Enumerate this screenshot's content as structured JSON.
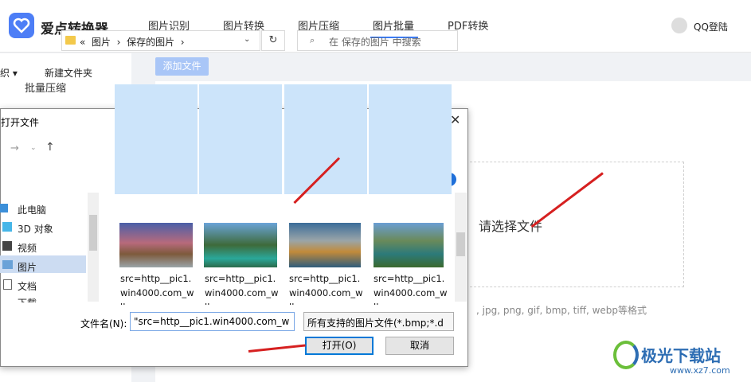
{
  "app": {
    "name": "爱点转换器",
    "login": "QQ登陆"
  },
  "nav": [
    {
      "label": "图片识别"
    },
    {
      "label": "图片转换"
    },
    {
      "label": "图片压缩"
    },
    {
      "label": "图片批量"
    },
    {
      "label": "PDF转换"
    }
  ],
  "sidebar": {
    "item": "批量压缩"
  },
  "main": {
    "add_button": "添加文件",
    "drop_text": "请选择文件",
    "formats": ", jpg, png, gif, bmp, tiff, webp等格式"
  },
  "dialog": {
    "title": "打开文件",
    "breadcrumb_prefix": "«",
    "crumb1": "图片",
    "crumb2": "保存的图片",
    "search_placeholder": "在 保存的图片 中搜索",
    "organize": "织 ▾",
    "new_folder": "新建文件夹",
    "tree": [
      "此电脑",
      "3D 对象",
      "视频",
      "图片",
      "文档",
      "下载"
    ],
    "files": [
      {
        "line1": "src=http__pic1.",
        "line2": "win4000.com_w",
        "line3": "ll"
      },
      {
        "line1": "src=http__pic1.",
        "line2": "win4000.com_w",
        "line3": "ll"
      },
      {
        "line1": "src=http__pic1.",
        "line2": "win4000.com_w",
        "line3": "ll"
      },
      {
        "line1": "src=http__pic1.",
        "line2": "win4000.com_w",
        "line3": "ll"
      }
    ],
    "filename_label": "文件名(N):",
    "filename_value": "\"src=http__pic1.win4000.com_w",
    "filter_value": "所有支持的图片文件(*.bmp;*.d",
    "open_button": "打开(O)",
    "cancel_button": "取消"
  },
  "watermark": {
    "name": "极光下载站",
    "url": "www.xz7.com"
  }
}
